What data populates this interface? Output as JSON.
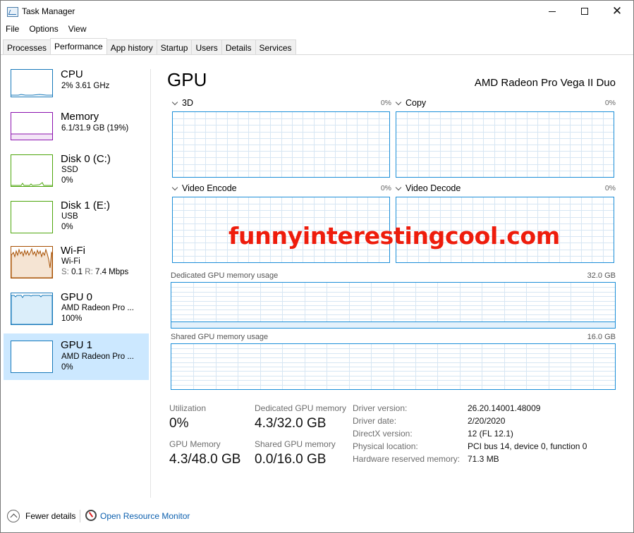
{
  "window": {
    "title": "Task Manager",
    "icon": "task-manager-icon"
  },
  "menu": [
    "File",
    "Options",
    "View"
  ],
  "tabs": [
    "Processes",
    "Performance",
    "App history",
    "Startup",
    "Users",
    "Details",
    "Services"
  ],
  "active_tab": "Performance",
  "sidebar": {
    "items": [
      {
        "title": "CPU",
        "line2": "2% 3.61 GHz",
        "line3": "",
        "color": "#1779ba"
      },
      {
        "title": "Memory",
        "line2": "6.1/31.9 GB (19%)",
        "line3": "",
        "color": "#8b12ae"
      },
      {
        "title": "Disk 0 (C:)",
        "line2": "SSD",
        "line3": "0%",
        "color": "#4da60c"
      },
      {
        "title": "Disk 1 (E:)",
        "line2": "USB",
        "line3": "0%",
        "color": "#4da60c"
      },
      {
        "title": "Wi-Fi",
        "line2": "Wi-Fi",
        "line3_s": "S:",
        "line3_s_val": "0.1",
        "line3_r": "R:",
        "line3_r_val": "7.4 Mbps",
        "color": "#a74f01"
      },
      {
        "title": "GPU 0",
        "line2": "AMD Radeon Pro ...",
        "line3": "100%",
        "color": "#1779ba"
      },
      {
        "title": "GPU 1",
        "line2": "AMD Radeon Pro ...",
        "line3": "0%",
        "color": "#1779ba",
        "selected": true
      }
    ]
  },
  "main": {
    "title": "GPU",
    "gpu_name": "AMD Radeon Pro Vega II Duo",
    "engines": [
      {
        "label": "3D",
        "pct": "0%"
      },
      {
        "label": "Copy",
        "pct": "0%"
      },
      {
        "label": "Video Encode",
        "pct": "0%"
      },
      {
        "label": "Video Decode",
        "pct": "0%"
      }
    ],
    "dedicated_memory": {
      "label": "Dedicated GPU memory usage",
      "max": "32.0 GB",
      "used_fraction": 0.134
    },
    "shared_memory": {
      "label": "Shared GPU memory usage",
      "max": "16.0 GB",
      "used_fraction": 0.0
    }
  },
  "stats": {
    "utilization": {
      "label": "Utilization",
      "value": "0%"
    },
    "dedicated": {
      "label": "Dedicated GPU memory",
      "value": "4.3/32.0 GB"
    },
    "gpu_memory": {
      "label": "GPU Memory",
      "value": "4.3/48.0 GB"
    },
    "shared": {
      "label": "Shared GPU memory",
      "value": "0.0/16.0 GB"
    }
  },
  "info": [
    {
      "label": "Driver version:",
      "value": "26.20.14001.48009"
    },
    {
      "label": "Driver date:",
      "value": "2/20/2020"
    },
    {
      "label": "DirectX version:",
      "value": "12 (FL 12.1)"
    },
    {
      "label": "Physical location:",
      "value": "PCI bus 14, device 0, function 0"
    },
    {
      "label": "Hardware reserved memory:",
      "value": "71.3 MB"
    }
  ],
  "watermark": "funnyinterestingcool.com",
  "footer": {
    "fewer_details": "Fewer details",
    "resource_monitor": "Open Resource Monitor"
  },
  "colors": {
    "gpu_accent": "#1b8ed8",
    "grid": "#d7e6f3",
    "selected_bg": "#cce8ff",
    "link": "#0b5fae",
    "watermark": "#ee1c0c"
  }
}
